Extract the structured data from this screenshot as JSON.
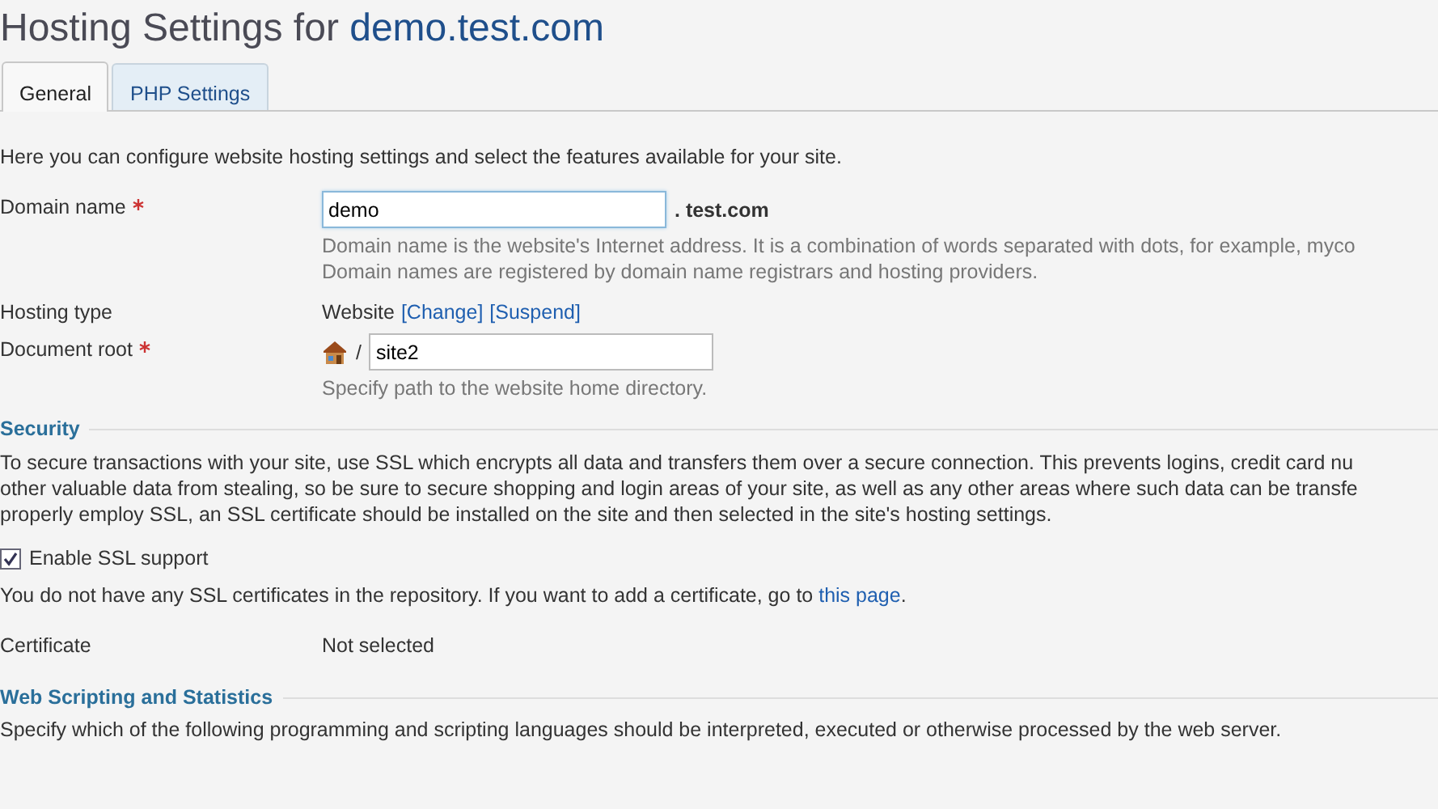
{
  "page_title": {
    "text": "Hosting Settings for",
    "domain": "demo.test.com"
  },
  "tabs": [
    {
      "label": "General",
      "selected": true
    },
    {
      "label": "PHP Settings",
      "selected": false
    }
  ],
  "intro": "Here you can configure website hosting settings and select the features available for your site.",
  "fields": [
    {
      "kind": "domain",
      "label": "Domain name",
      "required": true,
      "value": "demo",
      "suffix": ". test.com",
      "hint": [
        "Domain name is the website's Internet address. It is a combination of words separated with dots, for example, myco",
        "Domain names are registered by domain name registrars and hosting providers."
      ]
    },
    {
      "kind": "text",
      "label": "Hosting type",
      "required": false,
      "value": "Website",
      "links": [
        "[Change]",
        "[Suspend]"
      ]
    },
    {
      "kind": "path",
      "label": "Document root",
      "required": true,
      "separator": "/",
      "value": "site2",
      "hint": [
        "Specify path to the website home directory."
      ]
    }
  ],
  "security": {
    "title": "Security",
    "paragraph": [
      "To secure transactions with your site, use SSL which encrypts all data and transfers them over a secure connection. This prevents logins, credit card nu",
      "other valuable data from stealing, so be sure to secure shopping and login areas of your site, as well as any other areas where such data can be transfe",
      "properly employ SSL, an SSL certificate should be installed on the site and then selected in the site's hosting settings."
    ],
    "ssl_checkbox": {
      "label": "Enable SSL support",
      "checked": true
    },
    "note": "You do not have any SSL certificates in the repository. If you want to add a certificate, go to",
    "note_link": "this page",
    "note_end": ".",
    "certificate": {
      "label": "Certificate",
      "value": "Not selected"
    }
  },
  "web_scripting": {
    "title": "Web Scripting and Statistics",
    "description": "Specify which of the following programming and scripting languages should be interpreted, executed or otherwise processed by the web server."
  }
}
